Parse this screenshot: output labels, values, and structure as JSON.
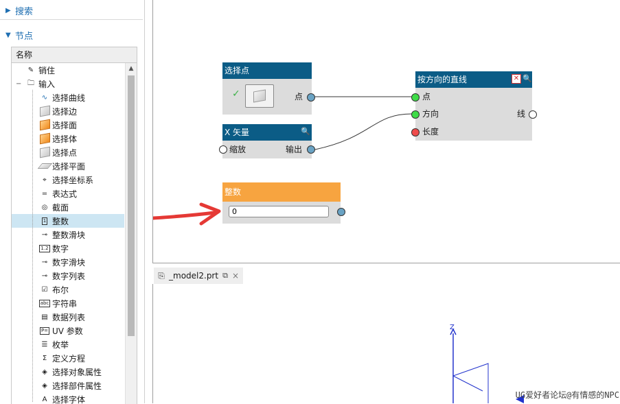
{
  "left_panel": {
    "search_label": "搜索",
    "nodes_label": "节点",
    "tree_header": "名称",
    "tree_items": [
      {
        "label": "销住",
        "icon": "pin-icon"
      },
      {
        "label": "输入",
        "icon": "folder-icon"
      },
      {
        "label": "选择曲线",
        "icon": "curve-icon"
      },
      {
        "label": "选择边",
        "icon": "edge-icon"
      },
      {
        "label": "选择面",
        "icon": "face-icon"
      },
      {
        "label": "选择体",
        "icon": "body-icon"
      },
      {
        "label": "选择点",
        "icon": "point-icon"
      },
      {
        "label": "选择平面",
        "icon": "plane-icon"
      },
      {
        "label": "选择坐标系",
        "icon": "csys-icon"
      },
      {
        "label": "表达式",
        "icon": "expression-icon"
      },
      {
        "label": "截面",
        "icon": "section-icon"
      },
      {
        "label": "整数",
        "icon": "integer-icon"
      },
      {
        "label": "整数滑块",
        "icon": "integer-slider-icon"
      },
      {
        "label": "数字",
        "icon": "number-icon"
      },
      {
        "label": "数字滑块",
        "icon": "number-slider-icon"
      },
      {
        "label": "数字列表",
        "icon": "number-list-icon"
      },
      {
        "label": "布尔",
        "icon": "checkbox-icon"
      },
      {
        "label": "字符串",
        "icon": "string-icon"
      },
      {
        "label": "数据列表",
        "icon": "data-list-icon"
      },
      {
        "label": "UV 参数",
        "icon": "uv-param-icon"
      },
      {
        "label": "枚举",
        "icon": "enum-icon"
      },
      {
        "label": "定义方程",
        "icon": "equation-icon"
      },
      {
        "label": "选择对象属性",
        "icon": "tag-icon"
      },
      {
        "label": "选择部件属性",
        "icon": "tag-icon"
      },
      {
        "label": "选择字体",
        "icon": "font-icon"
      }
    ]
  },
  "nodes": {
    "select_point": {
      "title": "选择点",
      "out_label": "点"
    },
    "x_vector": {
      "title": "X 矢量",
      "in_label": "缩放",
      "out_label": "输出"
    },
    "integer": {
      "title": "整数",
      "value": "0"
    },
    "line": {
      "title": "按方向的直线",
      "in1": "点",
      "in2": "方向",
      "in3": "长度",
      "out_label": "线"
    }
  },
  "tab": {
    "label": "_model2.prt",
    "close": "×"
  },
  "viewport": {
    "axis_z": "Z",
    "watermark": "UG爱好者论坛@有情感的NPC"
  },
  "colors": {
    "node_blue": "#0b5c86",
    "node_orange": "#f7a440",
    "accent_red": "#e53935",
    "link": "#1f6fb2"
  }
}
